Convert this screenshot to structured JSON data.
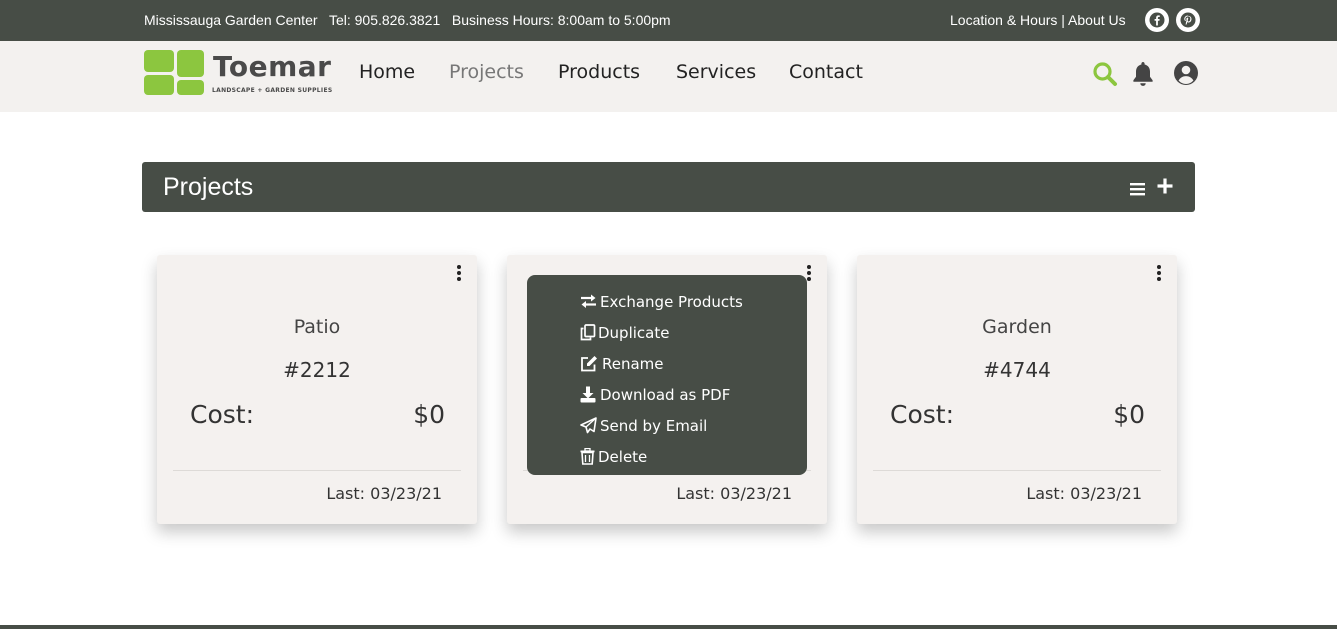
{
  "topbar": {
    "info": "Mississauga Garden Center   Tel: 905.826.3821   Business Hours: 8:00am to 5:00pm",
    "links": "Location & Hours | About Us",
    "social": [
      "facebook-icon",
      "pinterest-icon"
    ]
  },
  "brand": {
    "name": "Toemar",
    "tagline": "LANDSCAPE + GARDEN SUPPLIES"
  },
  "nav": {
    "items": [
      "Home",
      "Projects",
      "Products",
      "Services",
      "Contact"
    ],
    "active": "Projects",
    "icons": [
      "search-icon",
      "bell-icon",
      "user-icon"
    ]
  },
  "projects_header": {
    "title": "Projects",
    "icons": [
      "list-icon",
      "plus-icon"
    ]
  },
  "cards": [
    {
      "name": "Patio",
      "number": "#2212",
      "cost_label": "Cost:",
      "cost": "$0",
      "last": "Last: 03/23/21"
    },
    {
      "name": "",
      "number": "",
      "cost_label": "",
      "cost": "",
      "last": "Last: 03/23/21",
      "menu_open": true
    },
    {
      "name": "Garden",
      "number": "#4744",
      "cost_label": "Cost:",
      "cost": "$0",
      "last": "Last: 03/23/21"
    }
  ],
  "card_menu": {
    "items": [
      {
        "label": "Exchange Products",
        "icon": "exchange-icon"
      },
      {
        "label": "Duplicate",
        "icon": "copy-icon"
      },
      {
        "label": "Rename",
        "icon": "edit-icon"
      },
      {
        "label": "Download as PDF",
        "icon": "download-icon"
      },
      {
        "label": "Send by Email",
        "icon": "send-icon"
      },
      {
        "label": "Delete",
        "icon": "trash-icon"
      }
    ]
  },
  "colors": {
    "dark": "#474d46",
    "accent": "#8cc63f",
    "nav_bg": "#f3f1ef",
    "card_bg": "#f4f1ef"
  }
}
